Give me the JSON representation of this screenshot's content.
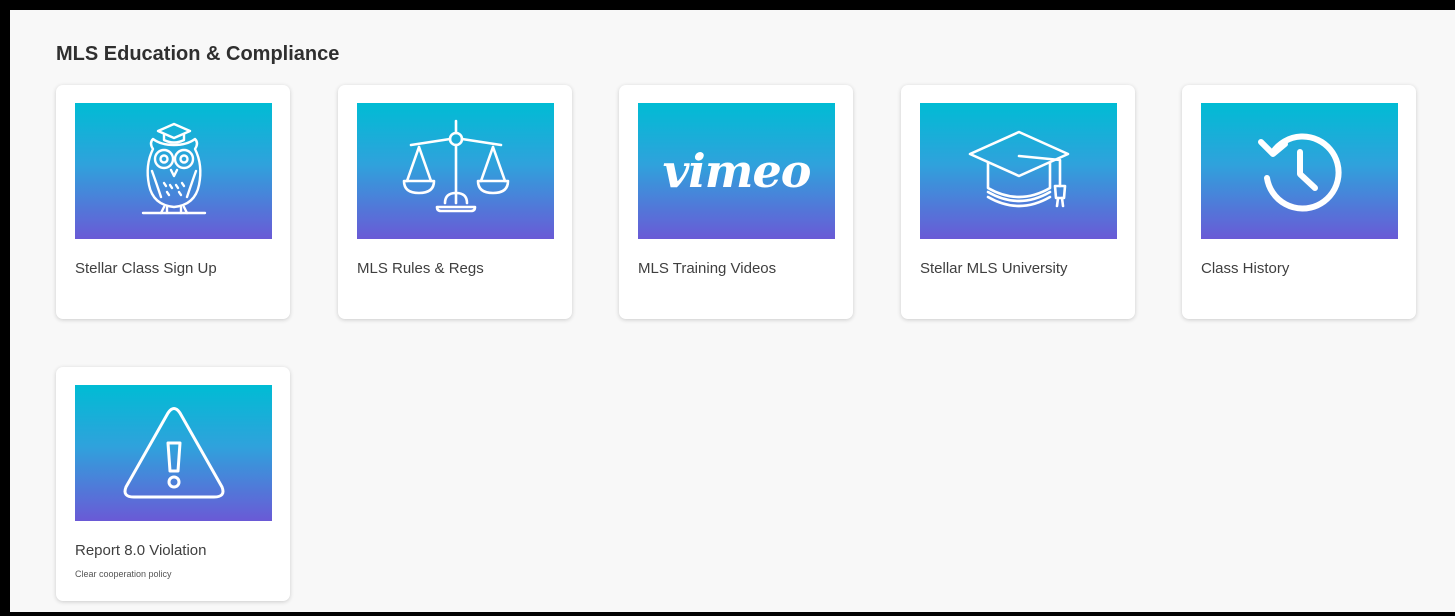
{
  "section": {
    "title": "MLS Education & Compliance"
  },
  "cards": [
    {
      "label": "Stellar Class Sign Up",
      "icon": "owl-icon"
    },
    {
      "label": "MLS Rules & Regs",
      "icon": "scales-icon"
    },
    {
      "label": "MLS Training Videos",
      "icon": "vimeo-logo",
      "logo_text": "vimeo"
    },
    {
      "label": "Stellar MLS University",
      "icon": "graduation-cap-icon"
    },
    {
      "label": "Class History",
      "icon": "history-clock-icon"
    },
    {
      "label": "Report 8.0 Violation",
      "sublabel": "Clear cooperation policy",
      "icon": "warning-icon"
    }
  ],
  "colors": {
    "gradient_top": "#00bcd4",
    "gradient_bottom": "#6a5ad6",
    "card_bg": "#ffffff",
    "page_bg": "#f8f8f8"
  }
}
